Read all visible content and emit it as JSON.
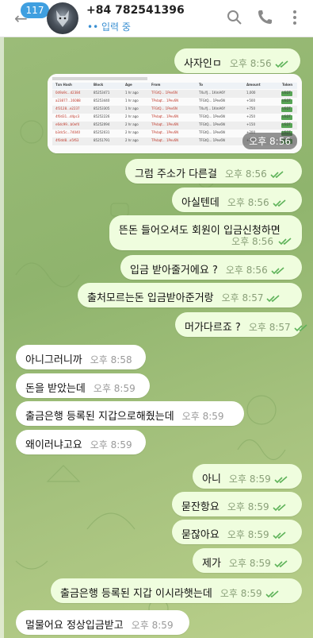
{
  "header": {
    "unread_count": "117",
    "contact_name": "+84 782541396",
    "status": "•• 입력 중"
  },
  "photo_message": {
    "time": "오후 8:56",
    "table_headers": [
      "Txn Hash",
      "Block",
      "Age",
      "From",
      "To",
      "Amount",
      "Token"
    ],
    "rows": [
      [
        "0d9a9c...d2384",
        "85253471",
        "1 hr ago",
        "TFGtQ... 1Pev6N",
        "TXuYJ... 1KmA6Y",
        "1,000",
        "USDT"
      ],
      [
        "a23877...16088",
        "85253440",
        "1 hr ago",
        "TPvbqt... 1Pev6N",
        "TFGtQ... 1Pev6N",
        "+500",
        "USDT"
      ],
      [
        "4f3128...e2237",
        "85253305",
        "1 hr ago",
        "TFGtQ... 1Pev6N",
        "TXuYJ... 1KmA6Y",
        "+750",
        "USDT"
      ],
      [
        "4f0d31...d4pc3",
        "85252226",
        "2 hr ago",
        "TPvbqt... 1Pev6N",
        "TFGtQ... 1Pev6N",
        "+250",
        "USDT"
      ],
      [
        "e6dc99...b0ef4",
        "85252094",
        "2 hr ago",
        "TPvbqt... 1Pev6N",
        "TFGtQ... 1Pev6N",
        "+150",
        "USDT"
      ],
      [
        "b3dc5c...74040",
        "85252031",
        "2 hr ago",
        "TPvbqt... 1Pev6N",
        "TFGtQ... 1Pev6N",
        "+200",
        "USDT"
      ],
      [
        "4f0dd8...e5f63",
        "85251791",
        "2 hr ago",
        "TPvbqt... 1Pev6N",
        "TFGtQ... 1Pev6N",
        "+300",
        "USDT"
      ]
    ]
  },
  "messages": [
    {
      "dir": "out",
      "text": "사자인ㅁ",
      "time": "오후 8:56"
    },
    {
      "dir": "out",
      "text": "그럼 주소가 다른걸",
      "time": "오후 8:56"
    },
    {
      "dir": "out",
      "text": "아실텐데",
      "time": "오후 8:56"
    },
    {
      "dir": "out",
      "text": "뜬돈 들어오셔도 회원이 입금신청하면",
      "time": "오후 8:56"
    },
    {
      "dir": "out",
      "text": "입금 받아줄거에요 ?",
      "time": "오후 8:56"
    },
    {
      "dir": "out",
      "text": "출처모르는돈 입금받아준거랑",
      "time": "오후 8:57"
    },
    {
      "dir": "out",
      "text": "머가다르죠 ?",
      "time": "오후 8:57"
    },
    {
      "dir": "in",
      "text": "아니그러니까",
      "time": "오후 8:58"
    },
    {
      "dir": "in",
      "text": "돈을 받았는데",
      "time": "오후 8:59"
    },
    {
      "dir": "in",
      "text": "출금은행 등록된 지갑으로해줬는데",
      "time": "오후 8:59"
    },
    {
      "dir": "in",
      "text": "왜이러냐고요",
      "time": "오후 8:59"
    },
    {
      "dir": "out",
      "text": "아니",
      "time": "오후 8:59"
    },
    {
      "dir": "out",
      "text": "묻잔항요",
      "time": "오후 8:59"
    },
    {
      "dir": "out",
      "text": "묻잖아요",
      "time": "오후 8:59"
    },
    {
      "dir": "out",
      "text": "제가",
      "time": "오후 8:59"
    },
    {
      "dir": "out",
      "text": "출금은행 등록된 지갑 이시라햇는데",
      "time": "오후 8:59"
    },
    {
      "dir": "in",
      "text": "멀물어요 정상입금받고",
      "time": "오후 8:59"
    }
  ],
  "colors": {
    "outgoing_bubble": "#effdde",
    "incoming_bubble": "#ffffff",
    "check": "#5fb35a",
    "accent": "#3a8fd2"
  },
  "icons": [
    "back-arrow-icon",
    "search-icon",
    "phone-icon",
    "more-vertical-icon",
    "double-check-icon"
  ]
}
